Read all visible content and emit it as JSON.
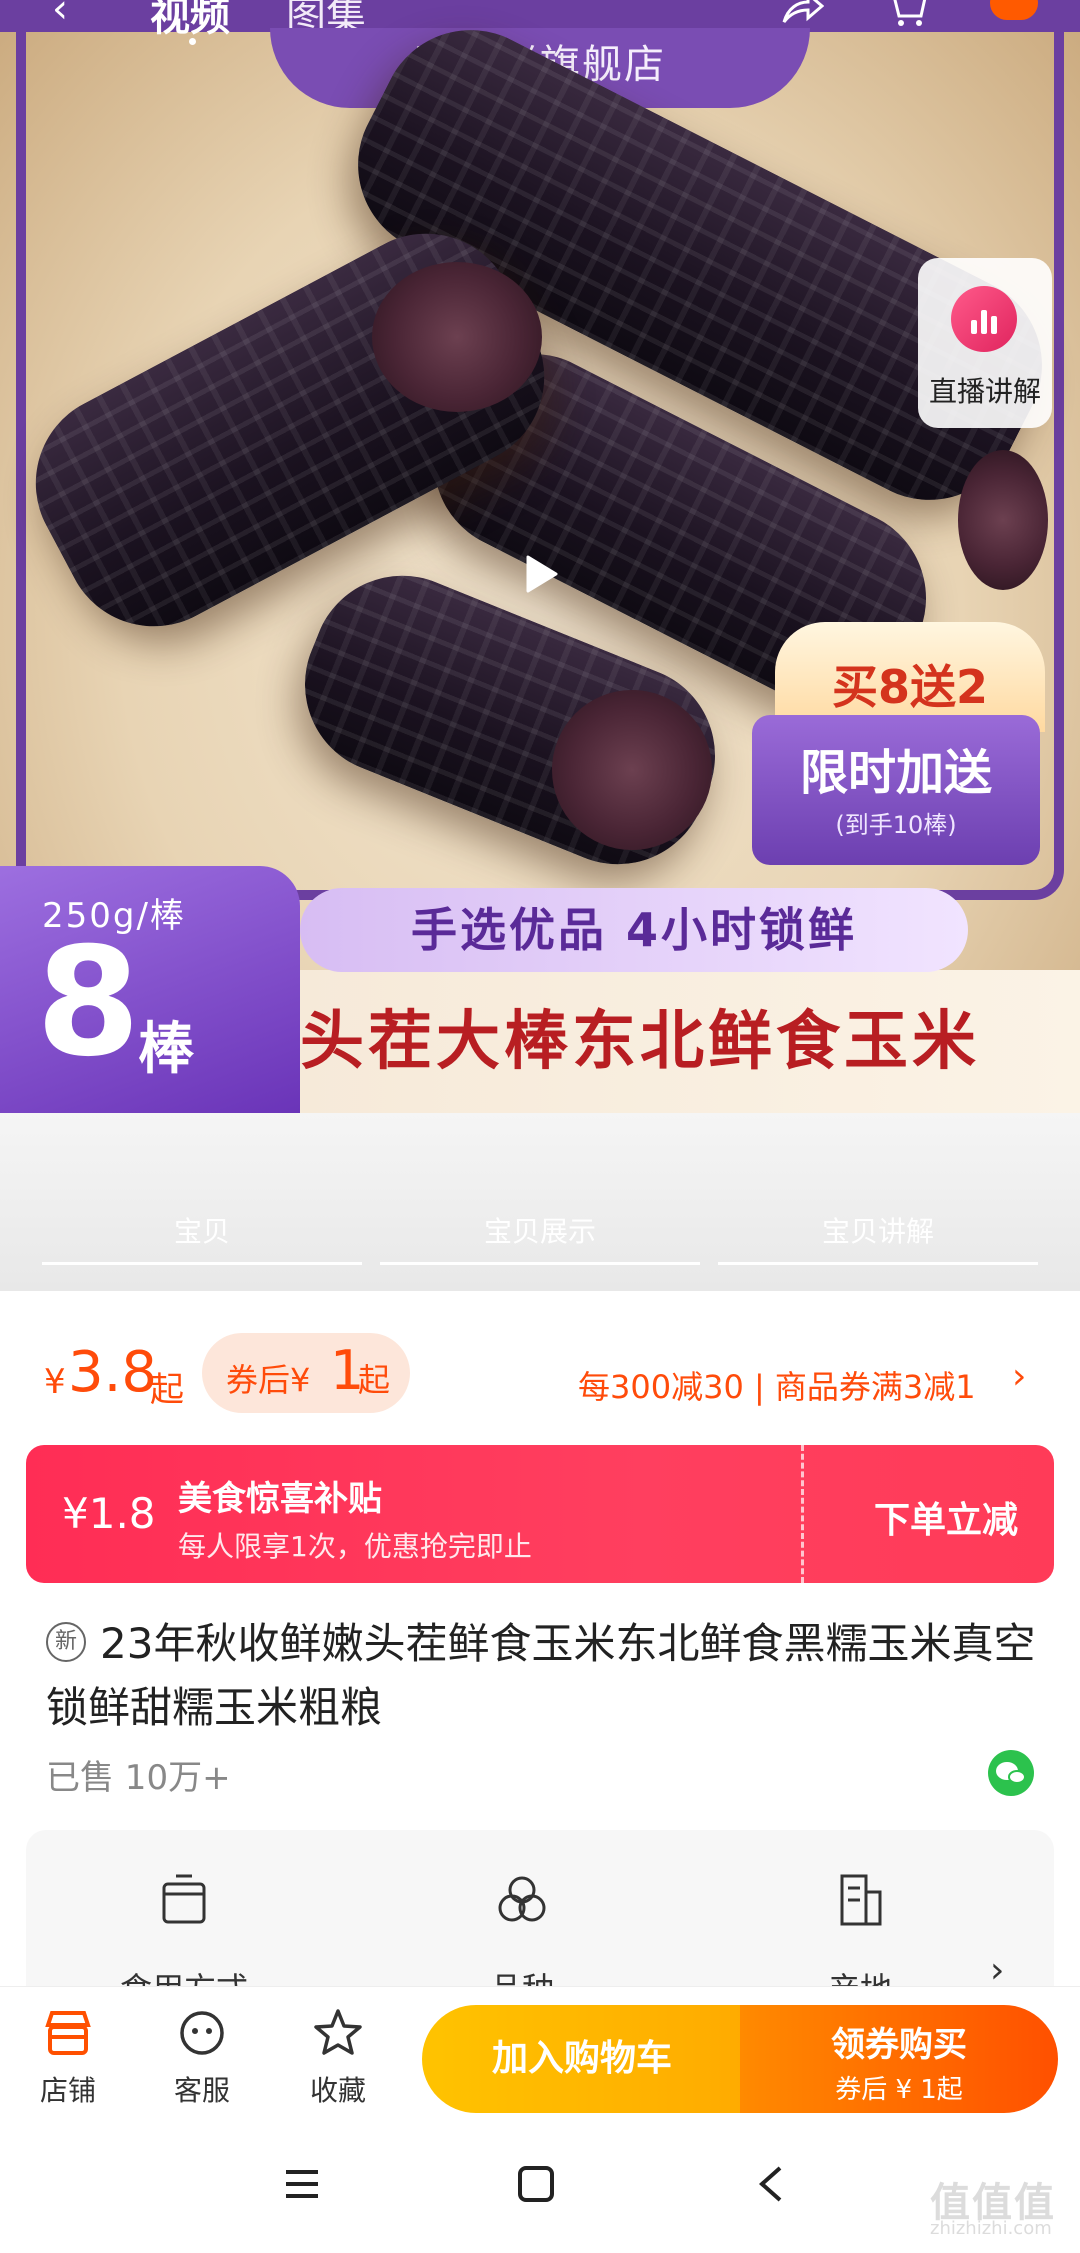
{
  "header": {
    "tabs": [
      "视频",
      "图集"
    ]
  },
  "hero": {
    "store_banner": "园依鲜旗舰店",
    "live_label": "直播讲解",
    "promo_top": "买8送2",
    "promo_main": "限时加送",
    "promo_sub": "(到手10棒)",
    "spec_weight": "250g/棒",
    "spec_number": "8",
    "spec_unit": "棒",
    "slogan": "手选优品  4小时锁鲜",
    "big_title": "头茬大棒东北鲜食玉米"
  },
  "anchor_tabs": [
    "宝贝",
    "宝贝展示",
    "宝贝讲解"
  ],
  "price": {
    "currency": "¥",
    "value": "3.8",
    "suffix": "起",
    "coupon_prefix": "券后¥",
    "coupon_value": "1",
    "coupon_suffix": "起",
    "discount_text": "每300减30 | 商品券满3减1",
    "discount_arrow": "›"
  },
  "subsidy": {
    "amount": "¥1.8",
    "title": "美食惊喜补贴",
    "desc": "每人限享1次，优惠抢完即止",
    "action": "下单立减"
  },
  "product": {
    "new_badge": "新",
    "title": "23年秋收鲜嫩头茬鲜食玉米东北鲜食黑糯玉米真空锁鲜甜糯玉米粗粮",
    "sold": "已售 10万+"
  },
  "attributes": [
    {
      "label": "食用方式",
      "icon": "pot-icon"
    },
    {
      "label": "品种",
      "icon": "circles-icon"
    },
    {
      "label": "产地",
      "icon": "building-icon"
    }
  ],
  "action_bar": {
    "store": "店铺",
    "service": "客服",
    "favorite": "收藏",
    "add_cart": "加入购物车",
    "buy_main": "领券购买",
    "buy_sub": "券后 ¥ 1起"
  },
  "watermark": {
    "main": "值值值",
    "sub": "zhizhizhi.com"
  },
  "colors": {
    "accent": "#ff4b0a",
    "purple": "#6b3fa0",
    "subsidy_red": "#ff2d55",
    "cart_yellow": "#ffc300",
    "buy_orange": "#ff5000"
  }
}
